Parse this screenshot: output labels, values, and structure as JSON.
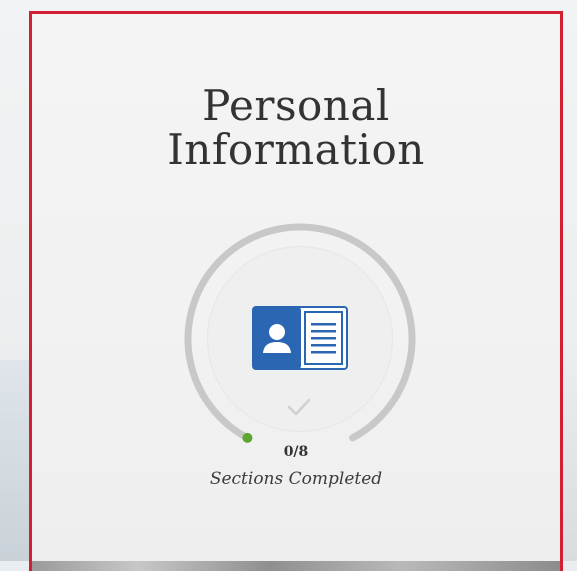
{
  "section": {
    "title_line1": "Personal",
    "title_line2": "Information"
  },
  "progress": {
    "completed": 0,
    "total": 8,
    "count_text": "0/8",
    "label": "Sections Completed",
    "fraction": 0
  },
  "colors": {
    "card_border": "#d31f33",
    "icon_blue": "#2a66b1",
    "track_gray": "#c8c8c8",
    "indicator_green": "#5aa62e",
    "check_gray": "#d0d0d0"
  },
  "icons": {
    "section_icon": "id-card-icon",
    "status_icon": "check-icon"
  }
}
